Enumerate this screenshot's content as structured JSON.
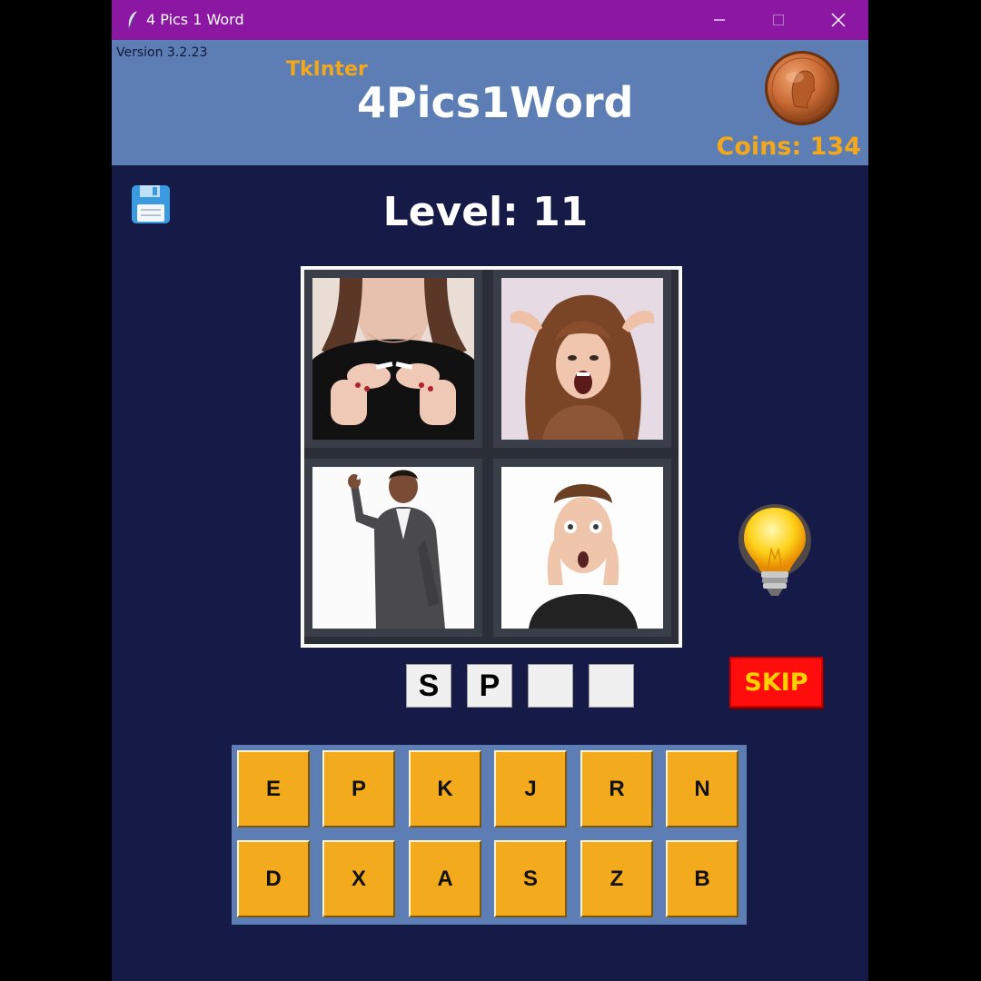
{
  "window": {
    "title": "4 Pics 1 Word",
    "app_icon": "feather-icon"
  },
  "header": {
    "version": "Version 3.2.23",
    "subtitle": "TkInter",
    "title": "4Pics1Word",
    "coins_label": "Coins: 134",
    "coin_icon": "penny-coin-icon"
  },
  "game": {
    "level_label": "Level: 11",
    "pictures": [
      "breaking-cigarette",
      "screaming-woman",
      "woman-in-suit",
      "shocked-man"
    ],
    "answer_slots": [
      "S",
      "P",
      "",
      ""
    ],
    "skip_label": "SKIP",
    "hint_icon": "lightbulb-icon",
    "save_icon": "floppy-disk-icon",
    "letters": [
      [
        "E",
        "P",
        "K",
        "J",
        "R",
        "N"
      ],
      [
        "D",
        "X",
        "A",
        "S",
        "Z",
        "B"
      ]
    ]
  },
  "colors": {
    "titlebar": "#8b17a3",
    "header": "#5c7eb4",
    "background": "#161a46",
    "accent": "#f3a81b",
    "skip": "#ff0c0c"
  }
}
